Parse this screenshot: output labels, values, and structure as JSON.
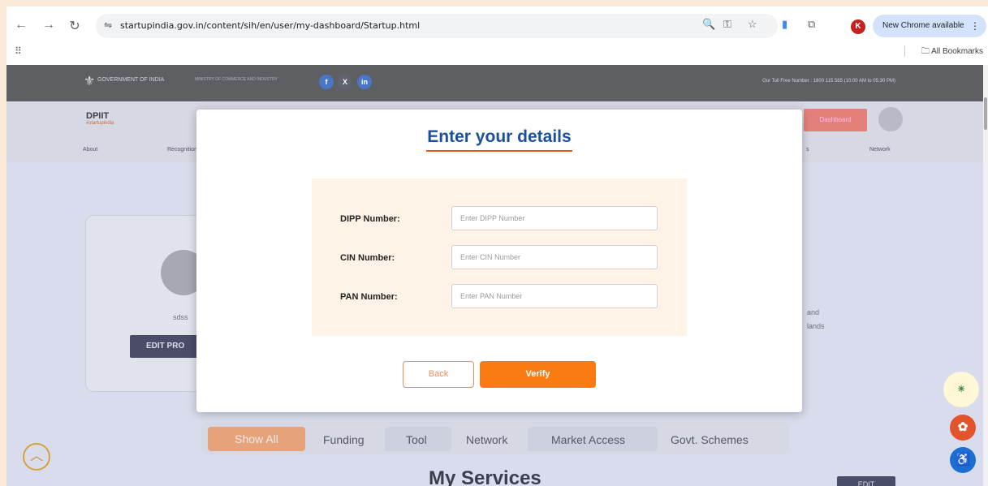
{
  "browser": {
    "url": "startupindia.gov.in/content/sih/en/user/my-dashboard/Startup.html",
    "new_chrome": "New Chrome available",
    "profile_initial": "K",
    "all_bookmarks": "All Bookmarks"
  },
  "site": {
    "gov_label": "GOVERNMENT OF INDIA",
    "ministry_label": "MINISTRY OF COMMERCE AND INDUSTRY",
    "toll_free": "Our Toll Free Number : 1800 115 565 (10:00 AM to 05:30 PM)",
    "logo": "DPIIT",
    "logo_sub": "#startupindia",
    "dashboard_button": "Dashboard",
    "nav": [
      "About",
      "Recognition",
      "s",
      "Network"
    ],
    "user_name": "sdss",
    "edit_profile": "EDIT PRO",
    "side_text": [
      "and",
      "lands"
    ],
    "tabs": [
      "Show All",
      "Funding",
      "Tool",
      "Network",
      "Market Access",
      "Govt. Schemes"
    ],
    "services_title": "My Services",
    "edit": "EDIT"
  },
  "modal": {
    "title": "Enter your details",
    "fields": [
      {
        "label": "DIPP Number:",
        "placeholder": "Enter DIPP Number"
      },
      {
        "label": "CIN Number:",
        "placeholder": "Enter CIN Number"
      },
      {
        "label": "PAN Number:",
        "placeholder": "Enter PAN Number"
      }
    ],
    "back_label": "Back",
    "verify_label": "Verify"
  },
  "colors": {
    "accent": "#f97b12",
    "title_blue": "#1e4f9c",
    "underline": "#e8590c"
  }
}
